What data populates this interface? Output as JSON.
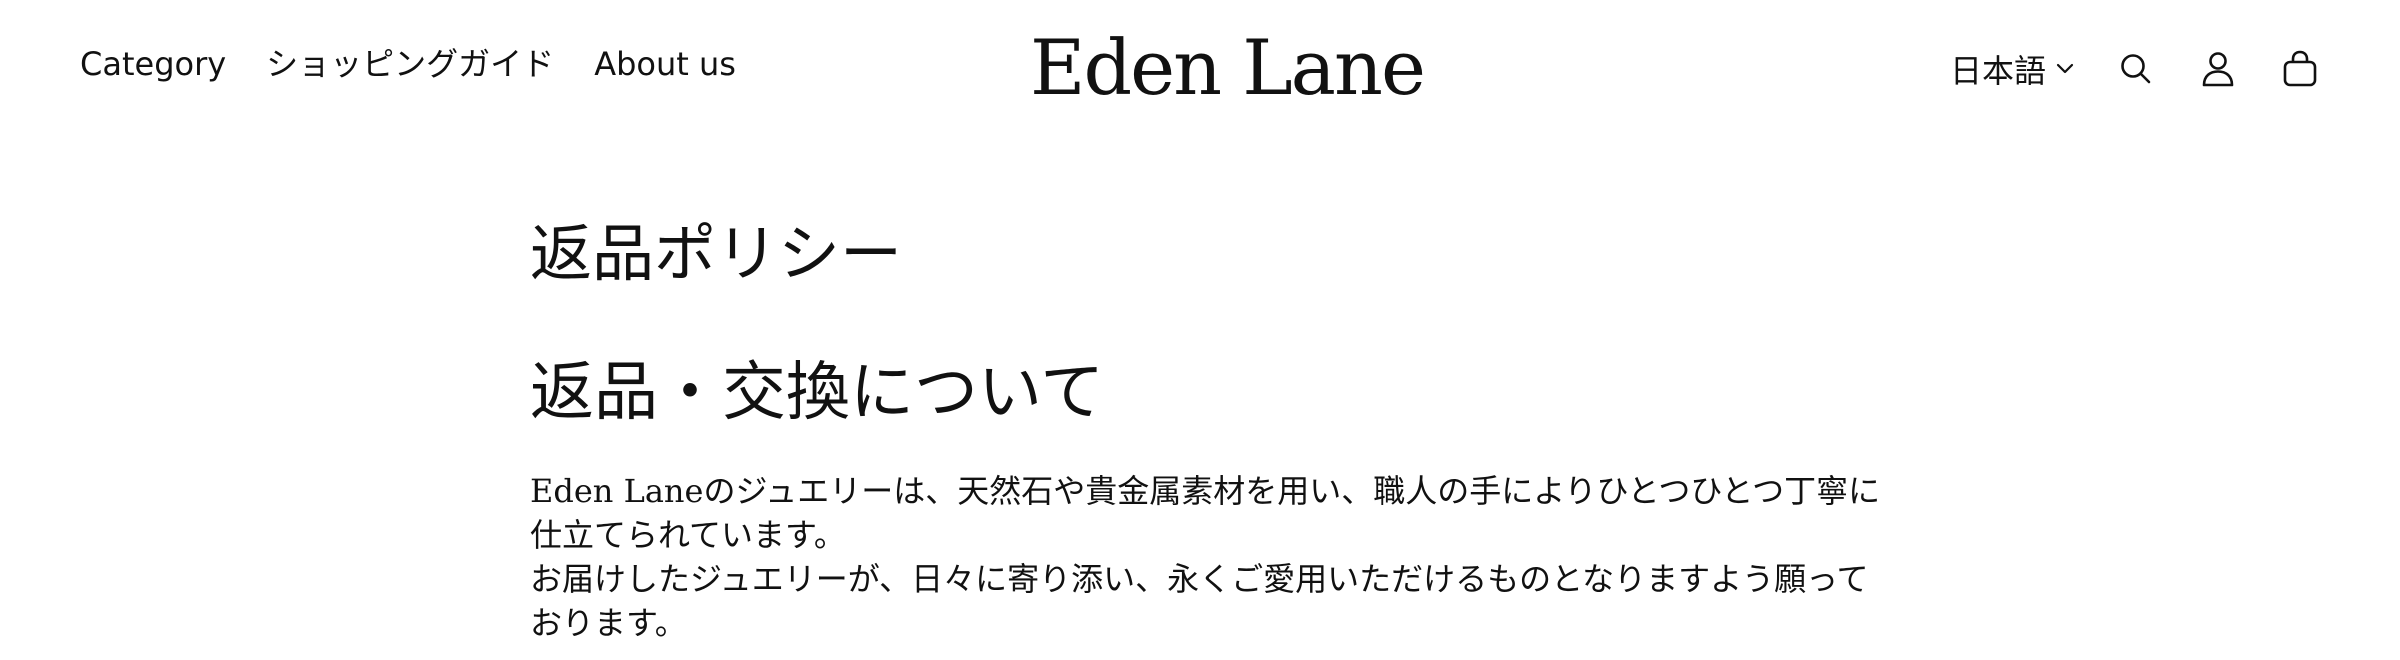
{
  "header": {
    "nav": {
      "category": "Category",
      "shopping_guide": "ショッピングガイド",
      "about": "About us"
    },
    "logo": "Eden Lane",
    "language": "日本語",
    "icons": {
      "language_chevron": "chevron-down-icon",
      "search": "search-icon",
      "account": "user-icon",
      "cart": "shopping-bag-icon"
    }
  },
  "main": {
    "page_title": "返品ポリシー",
    "section_heading": "返品・交換について",
    "paragraphs": [
      "Eden Laneのジュエリーは、天然石や貴金属素材を用い、職人の手によりひとつひとつ丁寧に仕立てられています。",
      "お届けしたジュエリーが、日々に寄り添い、永くご愛用いただけるものとなりますよう願っております。"
    ]
  },
  "colors": {
    "text": "#111111",
    "background": "#ffffff"
  }
}
